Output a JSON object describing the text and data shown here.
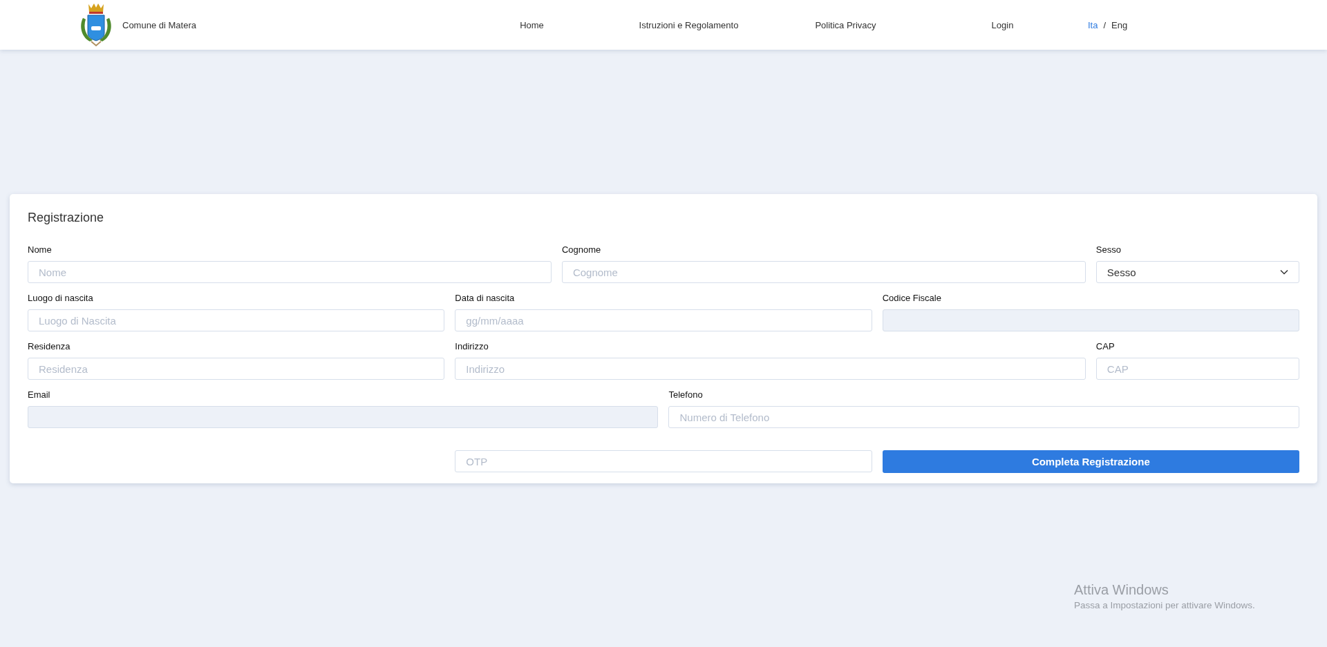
{
  "header": {
    "site_name": "Comune di Matera",
    "nav": [
      {
        "label": "Home"
      },
      {
        "label": "Istruzioni e Regolamento"
      },
      {
        "label": "Politica Privacy"
      },
      {
        "label": "Login"
      }
    ],
    "languages": [
      {
        "label": "Ita",
        "selected": true
      },
      {
        "label": "Eng",
        "selected": false
      }
    ],
    "language_separator": "/"
  },
  "form": {
    "title": "Registrazione",
    "rows": [
      [
        {
          "kind": "text",
          "label": "Nome",
          "placeholder": "Nome",
          "disabled": false
        },
        {
          "kind": "text",
          "label": "Cognome",
          "placeholder": "Cognome",
          "disabled": false
        },
        {
          "kind": "select",
          "label": "Sesso",
          "value": "Sesso",
          "disabled": false
        }
      ],
      [
        {
          "kind": "text",
          "label": "Luogo di nascita",
          "placeholder": "Luogo di Nascita",
          "disabled": false
        },
        {
          "kind": "text",
          "label": "Data di nascita",
          "placeholder": "gg/mm/aaaa",
          "disabled": false
        },
        {
          "kind": "text",
          "label": "Codice Fiscale",
          "disabled": true
        }
      ],
      [
        {
          "kind": "text",
          "label": "Residenza",
          "placeholder": "Residenza",
          "disabled": false
        },
        {
          "kind": "text",
          "label": "Indirizzo",
          "placeholder": "Indirizzo",
          "disabled": false
        },
        {
          "kind": "text",
          "label": "CAP",
          "placeholder": "CAP",
          "disabled": false
        }
      ],
      [
        {
          "kind": "text",
          "label": "Email",
          "disabled": true
        },
        {
          "kind": "text",
          "label": "Telefono",
          "placeholder": "Numero di Telefono",
          "disabled": false
        }
      ]
    ],
    "otp": {
      "placeholder": "OTP"
    },
    "submit": "Completa Registrazione"
  },
  "os_watermark": {
    "title": "Attiva Windows",
    "subtitle": "Passa a Impostazioni per attivare Windows."
  }
}
